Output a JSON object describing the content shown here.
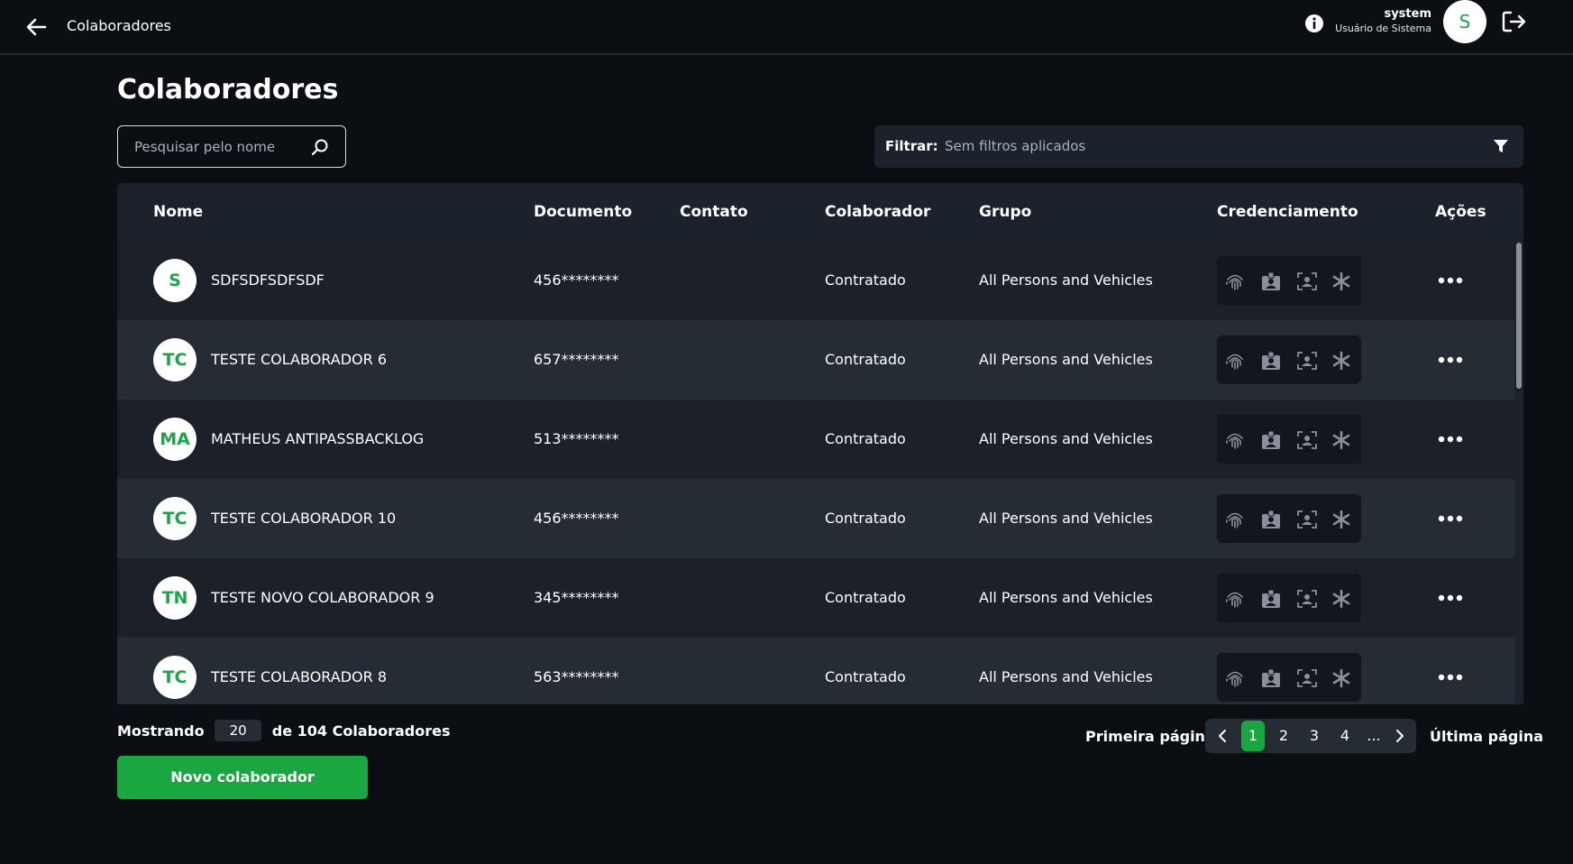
{
  "topbar": {
    "title": "Colaboradores",
    "user_name": "system",
    "user_role": "Usuário de Sistema",
    "avatar_initial": "S"
  },
  "page": {
    "title": "Colaboradores"
  },
  "search": {
    "placeholder": "Pesquisar pelo nome",
    "value": ""
  },
  "filter": {
    "label": "Filtrar:",
    "value": "Sem filtros aplicados"
  },
  "table": {
    "headers": {
      "nome": "Nome",
      "documento": "Documento",
      "contato": "Contato",
      "colaborador": "Colaborador",
      "grupo": "Grupo",
      "credenciamento": "Credenciamento",
      "acoes": "Ações"
    },
    "rows": [
      {
        "initials": "S",
        "name": "SDFSDFSDFSDF",
        "document": "456********",
        "contact": "",
        "type": "Contratado",
        "group": "All Persons and Vehicles"
      },
      {
        "initials": "TC",
        "name": "TESTE COLABORADOR 6",
        "document": "657********",
        "contact": "",
        "type": "Contratado",
        "group": "All Persons and Vehicles"
      },
      {
        "initials": "MA",
        "name": "MATHEUS ANTIPASSBACKLOG",
        "document": "513********",
        "contact": "",
        "type": "Contratado",
        "group": "All Persons and Vehicles"
      },
      {
        "initials": "TC",
        "name": "TESTE COLABORADOR 10",
        "document": "456********",
        "contact": "",
        "type": "Contratado",
        "group": "All Persons and Vehicles"
      },
      {
        "initials": "TN",
        "name": "TESTE NOVO COLABORADOR 9",
        "document": "345********",
        "contact": "",
        "type": "Contratado",
        "group": "All Persons and Vehicles"
      },
      {
        "initials": "TC",
        "name": "TESTE COLABORADOR 8",
        "document": "563********",
        "contact": "",
        "type": "Contratado",
        "group": "All Persons and Vehicles"
      }
    ]
  },
  "footer": {
    "showing_label": "Mostrando",
    "page_size": "20",
    "total_label": "de 104 Colaboradores",
    "new_button": "Novo colaborador"
  },
  "pagination": {
    "first_label": "Primeira página",
    "last_label": "Última página",
    "pages": [
      "1",
      "2",
      "3",
      "4",
      "..."
    ],
    "current": "1"
  },
  "colors": {
    "accent": "#1aa640",
    "background": "#0b0f14",
    "panel": "#1b222c"
  },
  "icons": {
    "credential_icons": [
      "fingerprint-icon",
      "badge-icon",
      "face-recognition-icon",
      "asterisk-icon"
    ]
  }
}
